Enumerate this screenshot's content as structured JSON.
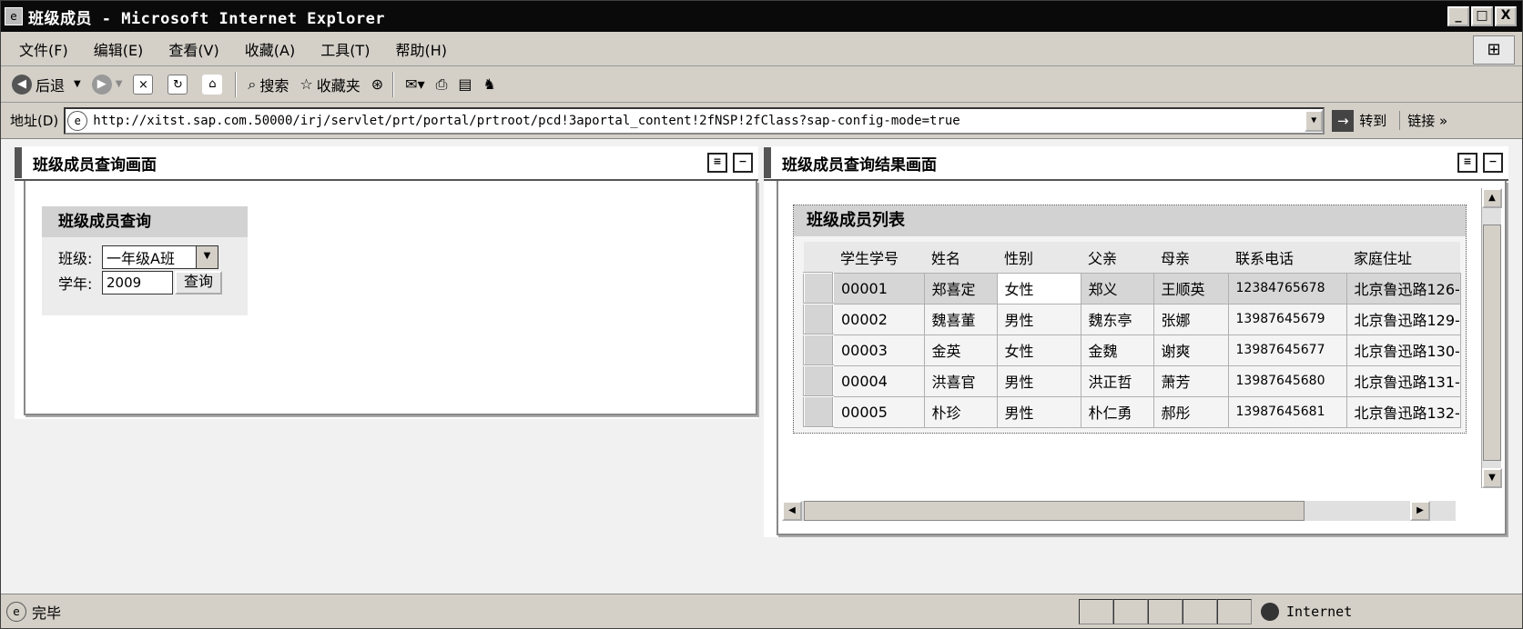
{
  "window": {
    "title": "班级成员 - Microsoft Internet Explorer",
    "buttons": {
      "minimize": "_",
      "maximize": "□",
      "close": "X"
    }
  },
  "menu": [
    "文件(F)",
    "编辑(E)",
    "查看(V)",
    "收藏(A)",
    "工具(T)",
    "帮助(H)"
  ],
  "toolbar": {
    "back": "后退",
    "search": "搜索",
    "favorites": "收藏夹"
  },
  "address": {
    "label": "地址(D)",
    "url": "http://xitst.sap.com.50000/irj/servlet/prt/portal/prtroot/pcd!3aportal_content!2fNSP!2fClass?sap-config-mode=true",
    "go": "转到",
    "links": "链接 »"
  },
  "left_view": {
    "title": "班级成员查询画面",
    "group_title": "班级成员查询",
    "class_label": "班级:",
    "class_value": "一年级A班",
    "year_label": "学年:",
    "year_value": "2009",
    "query_button": "查询"
  },
  "right_view": {
    "title": "班级成员查询结果画面",
    "group_title": "班级成员列表",
    "columns": [
      "学生学号",
      "姓名",
      "性别",
      "父亲",
      "母亲",
      "联系电话",
      "家庭住址"
    ],
    "rows": [
      [
        "00001",
        "郑喜定",
        "女性",
        "郑义",
        "王顺英",
        "12384765678",
        "北京鲁迅路126-"
      ],
      [
        "00002",
        "魏喜董",
        "男性",
        "魏东亭",
        "张娜",
        "13987645679",
        "北京鲁迅路129-"
      ],
      [
        "00003",
        "金英",
        "女性",
        "金魏",
        "谢爽",
        "13987645677",
        "北京鲁迅路130-"
      ],
      [
        "00004",
        "洪喜官",
        "男性",
        "洪正哲",
        "萧芳",
        "13987645680",
        "北京鲁迅路131-"
      ],
      [
        "00005",
        "朴珍",
        "男性",
        "朴仁勇",
        "郝彤",
        "13987645681",
        "北京鲁迅路132-"
      ]
    ]
  },
  "status": {
    "text": "完毕",
    "zone": "Internet"
  }
}
